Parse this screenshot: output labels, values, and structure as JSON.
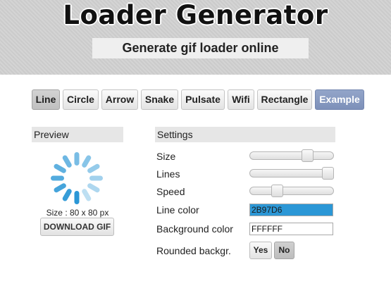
{
  "header": {
    "title": "Loader Generator",
    "subtitle": "Generate gif loader online"
  },
  "tabs": [
    {
      "label": "Line",
      "active": true
    },
    {
      "label": "Circle"
    },
    {
      "label": "Arrow"
    },
    {
      "label": "Snake"
    },
    {
      "label": "Pulsate"
    },
    {
      "label": "Wifi"
    },
    {
      "label": "Rectangle"
    },
    {
      "label": "Example",
      "highlight": true
    }
  ],
  "preview": {
    "heading": "Preview",
    "size_text": "Size : 80 x 80 px",
    "download_label": "DOWNLOAD GIF",
    "spinner_color": "#2B97D6"
  },
  "settings": {
    "heading": "Settings",
    "size_label": "Size",
    "size_level": 0.72,
    "lines_label": "Lines",
    "lines_level": 1.0,
    "speed_label": "Speed",
    "speed_level": 0.3,
    "line_color_label": "Line color",
    "line_color_value": "2B97D6",
    "bg_color_label": "Background color",
    "bg_color_value": "FFFFFF",
    "rounded_label": "Rounded backgr.",
    "yes_label": "Yes",
    "no_label": "No",
    "rounded_selected": "No"
  }
}
